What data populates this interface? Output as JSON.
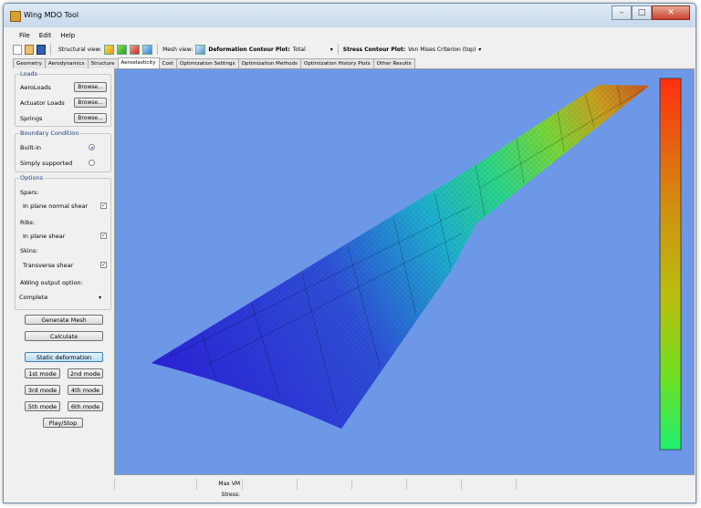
{
  "window": {
    "title": "Wing MDO Tool",
    "controls": {
      "minimize": "–",
      "maximize": "□",
      "close": "✕"
    }
  },
  "menu": [
    "File",
    "Edit",
    "Help"
  ],
  "toolbar": {
    "structural_view_label": "Structural view:",
    "mesh_view_label": "Mesh view:",
    "deformation_label": "Deformation Contour Plot:",
    "deformation_value": "Total",
    "stress_label": "Stress Contour Plot:",
    "stress_value": "Von Mises Criterion (top)"
  },
  "tabs": [
    "Geometry",
    "Aerodynamics",
    "Structure",
    "Aeroelasticity",
    "Cost",
    "Optimization Settings",
    "Optimization Methods",
    "Optimization History Plots",
    "Other Results"
  ],
  "active_tab": "Aeroelasticity",
  "loads": {
    "title": "Loads",
    "rows": [
      {
        "label": "AeroLoads",
        "button": "Browse..."
      },
      {
        "label": "Actuator Loads",
        "button": "Browse..."
      },
      {
        "label": "Springs",
        "button": "Browse..."
      }
    ]
  },
  "boundary": {
    "title": "Boundary Condition",
    "options": [
      {
        "label": "Built-in",
        "selected": true
      },
      {
        "label": "Simply supported",
        "selected": false
      }
    ]
  },
  "options": {
    "title": "Options",
    "spars_label": "Spars:",
    "spars_check": "In plane normal shear",
    "ribs_label": "Ribs:",
    "ribs_check": "In plane shear",
    "skins_label": "Skins:",
    "skins_check": "Transverse shear",
    "output_label": "AWing output option:",
    "output_value": "Complete"
  },
  "buttons": {
    "generate_mesh": "Generate Mesh",
    "calculate": "Calculate",
    "static_deformation": "Static deformation",
    "mode1": "1st mode",
    "mode2": "2nd mode",
    "mode3": "3rd mode",
    "mode4": "4th mode",
    "mode5": "5th mode",
    "mode6": "6th mode",
    "play_stop": "Play/Stop"
  },
  "status": {
    "max_vm_stress_label": "Max VM Stress:"
  },
  "colors": {
    "viewport_bg": "#6d98e8",
    "root_color": "#2a22d8",
    "tip_color": "#e83a14"
  }
}
